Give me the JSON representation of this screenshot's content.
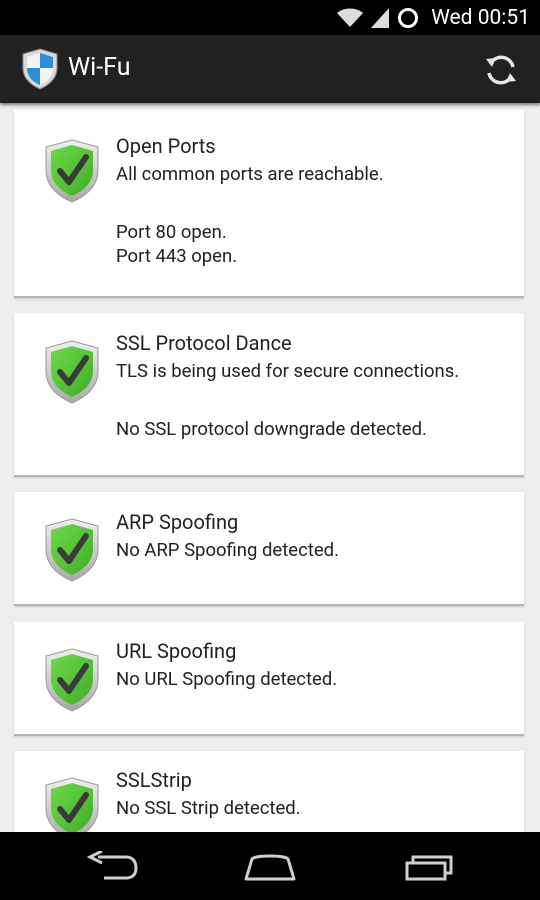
{
  "status_bar": {
    "time": "Wed 00:51"
  },
  "app": {
    "title": "Wi-Fu"
  },
  "cards": [
    {
      "title": "Open Ports",
      "summary": "All common ports are reachable.",
      "details": [
        "Port 80 open.",
        "Port 443 open."
      ]
    },
    {
      "title": "SSL Protocol Dance",
      "summary": "TLS is being used for secure connections.",
      "details": [
        "No SSL protocol downgrade detected."
      ]
    },
    {
      "title": "ARP Spoofing",
      "summary": "No ARP Spoofing detected.",
      "details": []
    },
    {
      "title": "URL Spoofing",
      "summary": "No URL Spoofing detected.",
      "details": []
    },
    {
      "title": "SSLStrip",
      "summary": "No SSL Strip detected.",
      "details": []
    }
  ],
  "icons": {
    "card_status": "shield-check-icon",
    "app": "shield-app-icon",
    "refresh": "refresh-icon"
  },
  "colors": {
    "check_green": "#5cc23a",
    "action_bar": "#212121",
    "background": "#eeeeee"
  }
}
